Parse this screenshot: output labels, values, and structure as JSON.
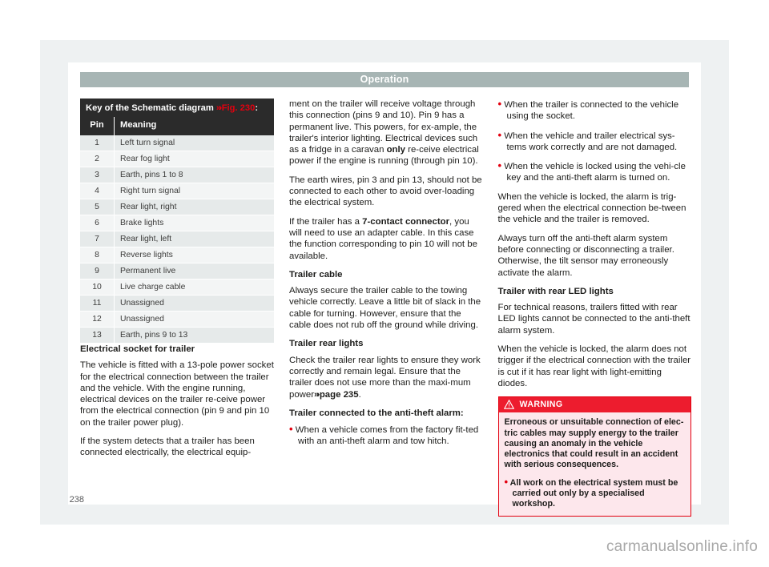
{
  "header": {
    "title": "Operation"
  },
  "page_number": "238",
  "watermark": "carmanualsonline.info",
  "table": {
    "caption_main": "Key of the Schematic diagram ",
    "caption_arrows": "»›",
    "caption_fig": "Fig. 230",
    "caption_end": ":",
    "columns": [
      "Pin",
      "Meaning"
    ],
    "rows": [
      {
        "pin": "1",
        "meaning": "Left turn signal"
      },
      {
        "pin": "2",
        "meaning": "Rear fog light"
      },
      {
        "pin": "3",
        "meaning": "Earth, pins 1 to 8"
      },
      {
        "pin": "4",
        "meaning": "Right turn signal"
      },
      {
        "pin": "5",
        "meaning": "Rear light, right"
      },
      {
        "pin": "6",
        "meaning": "Brake lights"
      },
      {
        "pin": "7",
        "meaning": "Rear light, left"
      },
      {
        "pin": "8",
        "meaning": "Reverse lights"
      },
      {
        "pin": "9",
        "meaning": "Permanent live"
      },
      {
        "pin": "10",
        "meaning": "Live charge cable"
      },
      {
        "pin": "11",
        "meaning": "Unassigned"
      },
      {
        "pin": "12",
        "meaning": "Unassigned"
      },
      {
        "pin": "13",
        "meaning": "Earth, pins 9 to 13"
      }
    ]
  },
  "col1": {
    "heading": "Electrical socket for trailer",
    "para1": "The vehicle is fitted with a 13-pole power socket for the electrical connection between the trailer and the vehicle. With the engine running, electrical devices on the trailer re-ceive power from the electrical connection (pin 9 and pin 10 on the trailer power plug).",
    "para2": "If the system detects that a trailer has been connected electrically, the electrical equip-"
  },
  "col2": {
    "para1_a": "ment on the trailer will receive voltage through this connection (pins 9 and 10). Pin 9 has a permanent live. This powers, for ex-ample, the trailer's interior lighting. Electrical devices such as a fridge in a caravan ",
    "para1_bold": "only",
    "para1_b": " re-ceive electrical power if the engine is running (through pin 10).",
    "para2": "The earth wires, pin 3 and pin 13, should not be connected to each other to avoid over-loading the electrical system.",
    "para3_a": "If the trailer has a ",
    "para3_bold": "7-contact connector",
    "para3_b": ", you will need to use an adapter cable. In this case the function corresponding to pin 10 will not be available.",
    "heading_cable": "Trailer cable",
    "para4": "Always secure the trailer cable to the towing vehicle correctly. Leave a little bit of slack in the cable for turning. However, ensure that the cable does not rub off the ground while driving.",
    "heading_rear_lights": "Trailer rear lights",
    "para5_a": "Check the trailer rear lights to ensure they work correctly and remain legal. Ensure that the trailer does not use more than the maxi-mum power",
    "para5_arrows": "»›",
    "para5_ref": "page 235",
    "para5_end": ".",
    "heading_antitheft": "Trailer connected to the anti-theft alarm:",
    "bullet1": "When a vehicle comes from the factory fit-ted with an anti-theft alarm and tow hitch."
  },
  "col3": {
    "bullet1": "When the trailer is connected to the vehicle using the socket.",
    "bullet2": "When the vehicle and trailer electrical sys-tems work correctly and are not damaged.",
    "bullet3": "When the vehicle is locked using the vehi-cle key and the anti-theft alarm is turned on.",
    "para1": "When the vehicle is locked, the alarm is trig-gered when the electrical connection be-tween the vehicle and the trailer is removed.",
    "para2": "Always turn off the anti-theft alarm system before connecting or disconnecting a trailer. Otherwise, the tilt sensor may erroneously activate the alarm.",
    "heading_led": "Trailer with rear LED lights",
    "para3": "For technical reasons, trailers fitted with rear LED lights cannot be connected to the anti-theft alarm system.",
    "para4": "When the vehicle is locked, the alarm does not trigger if the electrical connection with the trailer is cut if it has rear light with light-emitting diodes.",
    "warning": {
      "label": "WARNING",
      "para1": "Erroneous or unsuitable connection of elec-tric cables may supply energy to the trailer causing an anomaly in the vehicle electronics that could result in an accident with serious consequences.",
      "bullet1": "All work on the electrical system must be carried out only by a specialised workshop."
    }
  },
  "colors": {
    "header_bar": "#a7b5b4",
    "accent_red": "#e3000f",
    "warning_head": "#ed1c2e",
    "warning_bg": "#fde7ec",
    "table_header": "#2b2b2b"
  }
}
